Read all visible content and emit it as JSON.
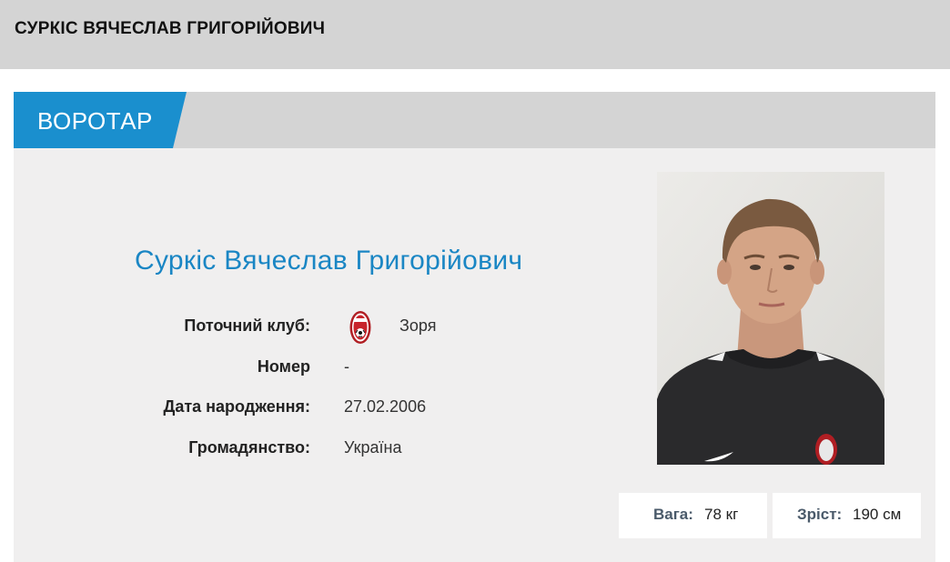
{
  "header": {
    "title": "СУРКІС ВЯЧЕСЛАВ ГРИГОРІЙОВИЧ"
  },
  "player": {
    "position": "ВОРОТАР",
    "name": "Суркіс Вячеслав Григорійович",
    "info": {
      "club_label": "Поточний клуб:",
      "club_value": "Зоря",
      "number_label": "Номер",
      "number_value": "-",
      "birth_label": "Дата народження:",
      "birth_value": "27.02.2006",
      "citizenship_label": "Громадянство:",
      "citizenship_value": "Україна"
    },
    "stats": {
      "weight_label": "Вага:",
      "weight_value": "78 кг",
      "height_label": "Зріст:",
      "height_value": "190 см"
    }
  },
  "colors": {
    "accent": "#1a8fce",
    "name_color": "#1a86c4",
    "header_bg": "#d4d4d4",
    "card_bg": "#f0efef"
  },
  "icons": {
    "club_logo": "zorya-club-logo-icon"
  }
}
